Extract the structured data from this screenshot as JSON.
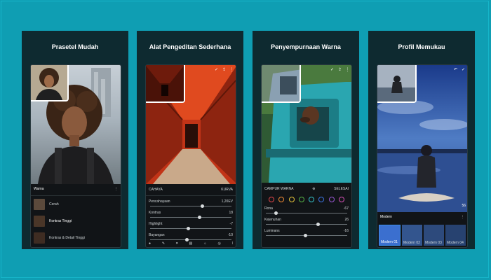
{
  "panels": [
    {
      "title": "Prasetel Mudah",
      "menu_label": "Warna",
      "items": [
        "Cerah",
        "Kontras Tinggi",
        "Kontras & Detail Tinggi"
      ]
    },
    {
      "title": "Alat Pengeditan Sederhana",
      "tab_left": "CAHAYA",
      "tab_right": "KURVA",
      "sliders": [
        {
          "label": "Pencahayaan",
          "value": "1,20EV"
        },
        {
          "label": "Kontras",
          "value": "18"
        },
        {
          "label": "Highlight",
          "value": "-7"
        },
        {
          "label": "Bayangan",
          "value": "-10"
        }
      ]
    },
    {
      "title": "Penyempurnaan Warna",
      "mix_label": "CAMPUR WARNA",
      "done_label": "SELESAI",
      "dot_colors": [
        "#e2464a",
        "#f08a34",
        "#e8c53a",
        "#57b447",
        "#36c3c9",
        "#3b73e0",
        "#9a58d6",
        "#d44fb6"
      ],
      "sliders": [
        {
          "label": "Rona",
          "value": "-67"
        },
        {
          "label": "Kejenuhan",
          "value": "26"
        },
        {
          "label": "Luminans",
          "value": "-16"
        }
      ]
    },
    {
      "title": "Profil Memukau",
      "profile_label": "Modern",
      "thumb_labels": [
        "Modern 01",
        "Modern 02",
        "Modern 03",
        "Modern 04"
      ],
      "value": "56"
    }
  ],
  "colors": {
    "background": "#0f9eb3",
    "panel": "#0e2a30",
    "accent": "#3b8ee8"
  }
}
